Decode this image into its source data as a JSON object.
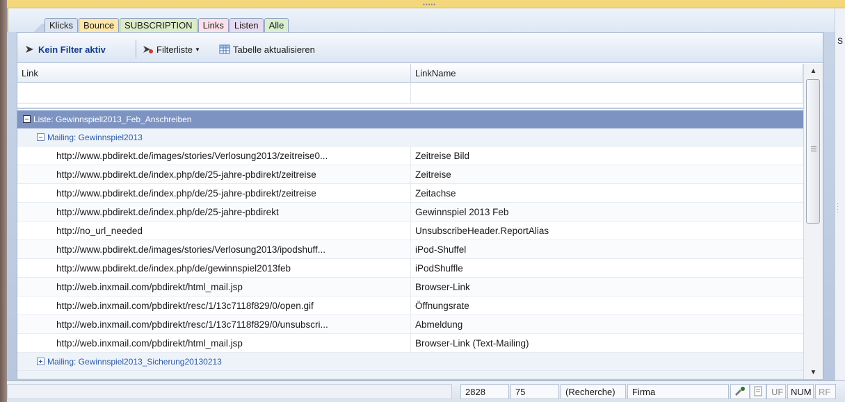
{
  "tabs": [
    {
      "label": "Klicks",
      "cls": "klicks"
    },
    {
      "label": "Bounce",
      "cls": "bounce"
    },
    {
      "label": "SUBSCRIPTION",
      "cls": "sub"
    },
    {
      "label": "Links",
      "cls": "links"
    },
    {
      "label": "Listen",
      "cls": "listen"
    },
    {
      "label": "Alle",
      "cls": "alle"
    }
  ],
  "toolbar": {
    "filter_status": "Kein Filter aktiv",
    "filterliste_label": "Filterliste",
    "refresh_label": "Tabelle aktualisieren"
  },
  "grid": {
    "columns": [
      "Link",
      "LinkName"
    ],
    "group_list": "Liste: Gewinnspiell2013_Feb_Anschreiben",
    "group_mailing": "Mailing: Gewinnspiel2013",
    "group_mailing2": "Mailing: Gewinnspiel2013_Sicherung20130213",
    "rows": [
      {
        "link": "http://www.pbdirekt.de/images/stories/Verlosung2013/zeitreise0...",
        "name": "Zeitreise Bild"
      },
      {
        "link": "http://www.pbdirekt.de/index.php/de/25-jahre-pbdirekt/zeitreise",
        "name": "Zeitreise"
      },
      {
        "link": "http://www.pbdirekt.de/index.php/de/25-jahre-pbdirekt/zeitreise",
        "name": "Zeitachse"
      },
      {
        "link": "http://www.pbdirekt.de/index.php/de/25-jahre-pbdirekt",
        "name": "Gewinnspiel 2013 Feb"
      },
      {
        "link": "http://no_url_needed",
        "name": "UnsubscribeHeader.ReportAlias"
      },
      {
        "link": "http://www.pbdirekt.de/images/stories/Verlosung2013/ipodshuff...",
        "name": "iPod-Shuffel"
      },
      {
        "link": "http://www.pbdirekt.de/index.php/de/gewinnspiel2013feb",
        "name": "iPodShuffle"
      },
      {
        "link": "http://web.inxmail.com/pbdirekt/html_mail.jsp",
        "name": "Browser-Link"
      },
      {
        "link": "http://web.inxmail.com/pbdirekt/resc/1/13c7118f829/0/open.gif",
        "name": "Öffnungsrate"
      },
      {
        "link": "http://web.inxmail.com/pbdirekt/resc/1/13c7118f829/0/unsubscri...",
        "name": "Abmeldung"
      },
      {
        "link": "http://web.inxmail.com/pbdirekt/html_mail.jsp",
        "name": "Browser-Link (Text-Mailing)"
      }
    ]
  },
  "side_label": "S",
  "statusbar": {
    "count1": "2828",
    "count2": "75",
    "mode": "(Recherche)",
    "company": "Firma",
    "uf": "UF",
    "num": "NUM",
    "rf": "RF"
  },
  "colors": {
    "group_list_bg": "#7d93c1",
    "mailing_text": "#2a5aa8",
    "filter_text": "#113a8a"
  }
}
